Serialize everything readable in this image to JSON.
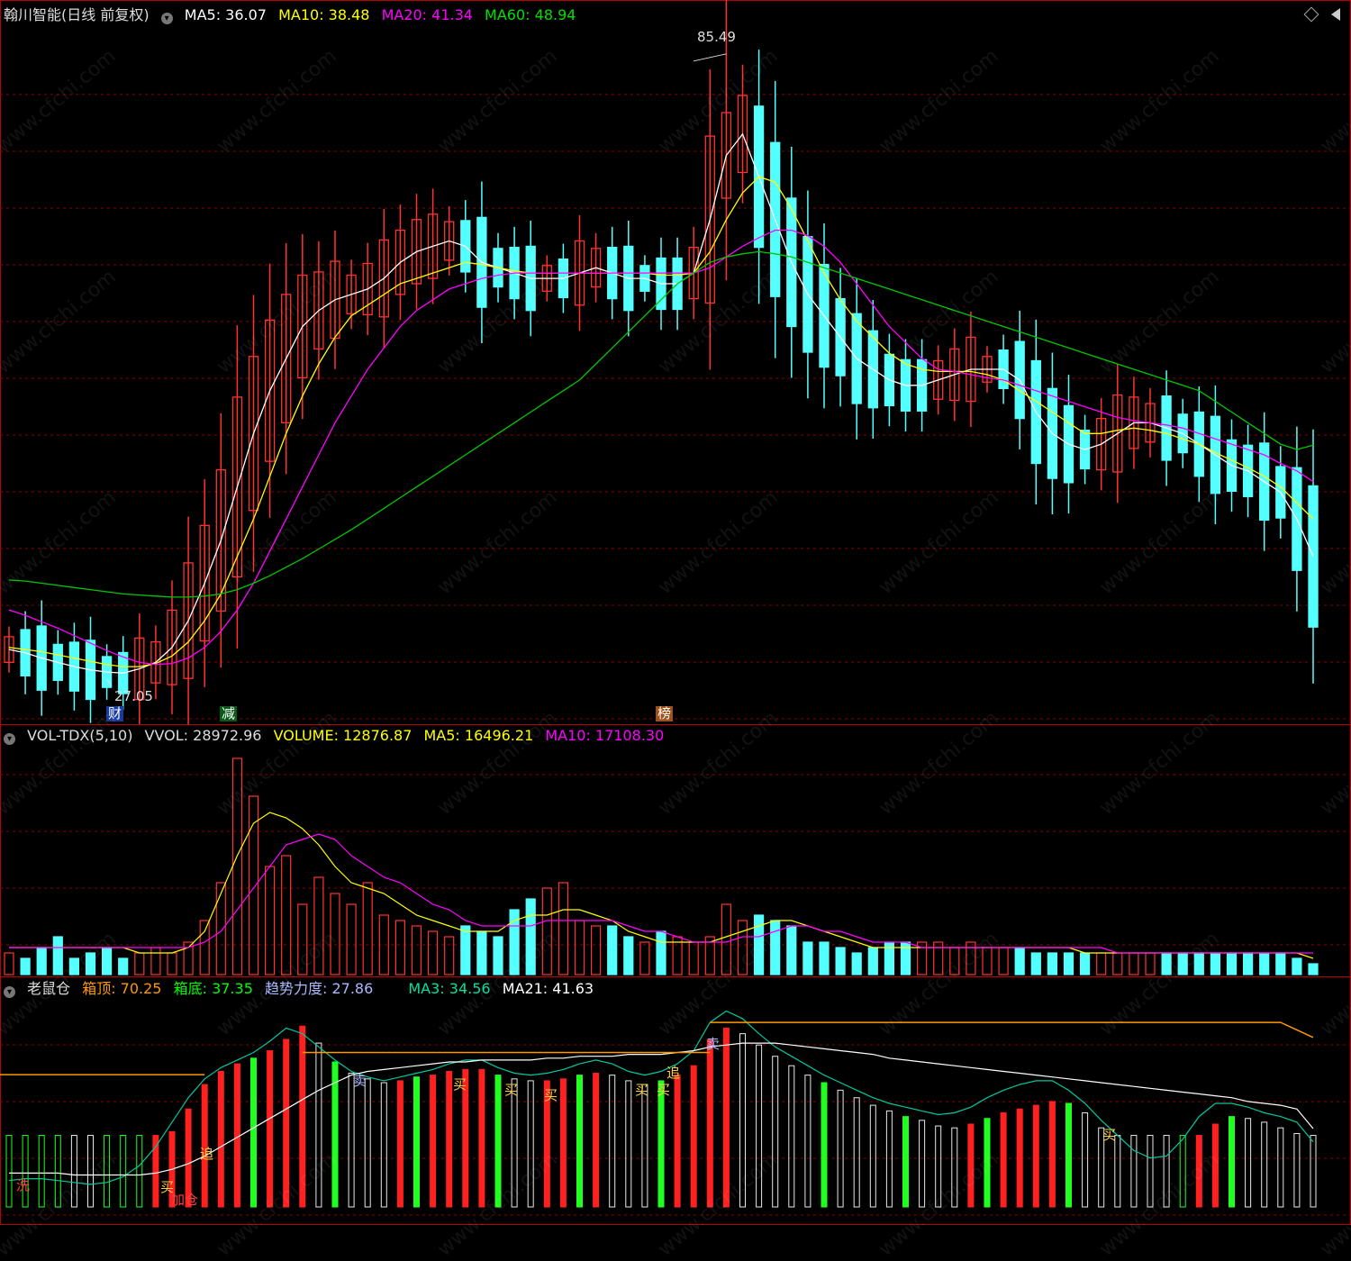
{
  "header": {
    "title": "翰川智能(日线 前复权)",
    "ma5": "MA5: 36.07",
    "ma10": "MA10: 38.48",
    "ma20": "MA20: 41.34",
    "ma60": "MA60: 48.94"
  },
  "price_marks": {
    "high": "85.49",
    "low": "27.05"
  },
  "event_tags": {
    "cai": "财",
    "jian": "减",
    "bang": "榜"
  },
  "volume_header": {
    "name": "VOL-TDX(5,10)",
    "vvol": "VVOL: 28972.96",
    "volume": "VOLUME: 12876.87",
    "ma5": "MA5: 16496.21",
    "ma10": "MA10: 17108.30"
  },
  "indicator_header": {
    "name": "老鼠仓",
    "top": "箱顶: 70.25",
    "bottom": "箱底: 37.35",
    "force": "趋势力度: 27.86",
    "ma3": "MA3: 34.56",
    "ma21": "MA21: 41.63"
  },
  "signals": {
    "buy": "买",
    "sell": "卖",
    "chase": "追",
    "wash": "洗",
    "add": "加仓"
  },
  "watermark": "www.cfchi.com",
  "colors": {
    "up": "#ff3232",
    "down": "#54ffff",
    "ma5": "#ffffff",
    "ma10": "#ffff00",
    "ma20": "#ff00ff",
    "ma60": "#00c800",
    "grid": "#8b0000",
    "box": "#ff9900"
  },
  "chart_data": [
    {
      "type": "candlestick",
      "ylim": [
        24,
        88
      ],
      "series": [
        {
          "name": "MA5",
          "values": [
            29.8,
            29.5,
            29,
            28.6,
            28.2,
            27.9,
            27.7,
            27.6,
            28,
            28.6,
            30,
            32.5,
            36,
            40,
            45,
            50,
            54,
            57,
            60,
            61.5,
            62.5,
            63,
            63.5,
            64.5,
            66,
            67,
            67.5,
            68,
            67.5,
            66,
            65.5,
            65,
            64.5,
            64.5,
            64.5,
            65,
            65.5,
            65,
            64.5,
            64.5,
            64,
            64,
            65,
            70,
            76,
            78,
            74,
            70,
            66,
            63,
            61,
            59,
            57,
            56,
            55,
            54.5,
            54.5,
            55,
            55.5,
            56,
            56,
            56,
            55,
            52,
            50,
            49,
            48.5,
            49,
            50,
            51,
            51,
            50.5,
            50,
            49,
            48,
            47,
            46.5,
            45.5,
            44.5,
            42,
            38.5
          ]
        },
        {
          "name": "MA10",
          "values": [
            30,
            29.8,
            29.6,
            29.3,
            29,
            28.7,
            28.4,
            28.2,
            28.2,
            28.5,
            29.2,
            30.5,
            32.5,
            35,
            38.5,
            42,
            46,
            50,
            53.5,
            56.5,
            59,
            61,
            62,
            63,
            64,
            64.5,
            65,
            65.5,
            66,
            65.8,
            65.5,
            65.2,
            65,
            65,
            65,
            65,
            65,
            65,
            65,
            65,
            64.8,
            64.8,
            65,
            67,
            70,
            72.5,
            74,
            73.5,
            71,
            68,
            65,
            62.5,
            60.5,
            59,
            57.5,
            56.5,
            56,
            55.8,
            55.8,
            55.8,
            55.5,
            55,
            54,
            53,
            52,
            51,
            50,
            50,
            50.3,
            50.5,
            50.3,
            50,
            49.5,
            49,
            48.2,
            47.5,
            46.8,
            46,
            45,
            43.5,
            42
          ]
        },
        {
          "name": "MA20",
          "values": [
            33.5,
            33,
            32.4,
            31.8,
            31.1,
            30.4,
            29.7,
            29.1,
            28.6,
            28.4,
            28.5,
            29,
            30,
            31.5,
            33.5,
            36,
            39,
            42,
            45,
            48,
            51,
            53.5,
            56,
            58,
            60,
            61.5,
            62.5,
            63.5,
            64,
            64.5,
            64.8,
            65,
            65,
            65,
            65,
            65,
            65,
            65,
            65,
            65,
            65,
            65,
            65,
            65.5,
            66.5,
            67.5,
            68.3,
            69,
            69,
            68.5,
            67.5,
            66,
            64,
            62,
            60,
            58.5,
            57,
            56,
            55.8,
            55.5,
            55.2,
            55,
            54.5,
            54,
            53.5,
            53,
            52.5,
            52,
            51.5,
            51.2,
            51,
            50.8,
            50.5,
            50,
            49.5,
            49,
            48.5,
            48,
            47.2,
            46.5,
            45.5
          ]
        },
        {
          "name": "MA60",
          "values": [
            36.3,
            36.2,
            36,
            35.8,
            35.6,
            35.4,
            35.2,
            35,
            34.9,
            34.8,
            34.7,
            34.7,
            34.8,
            35,
            35.4,
            36,
            36.7,
            37.5,
            38.3,
            39.2,
            40.1,
            41,
            42,
            43,
            44,
            45,
            46,
            47,
            48,
            49,
            50,
            51,
            52,
            53,
            54,
            55,
            56.5,
            58,
            59.5,
            61,
            62.5,
            64,
            65,
            66,
            66.5,
            66.8,
            67,
            66.8,
            66.5,
            66,
            65.5,
            65,
            64.5,
            64,
            63.5,
            63,
            62.5,
            62,
            61.5,
            61,
            60.5,
            60,
            59.5,
            59,
            58.5,
            58,
            57.5,
            57,
            56.5,
            56,
            55.5,
            55,
            54.5,
            54,
            53,
            52,
            51,
            50,
            49,
            48.5,
            48.9
          ]
        }
      ],
      "high": 85.49,
      "low": 27.05
    },
    {
      "type": "bar",
      "series": [
        {
          "name": "VOLUME",
          "values": [
            4,
            3,
            5,
            7,
            3,
            4,
            5,
            3,
            4,
            5,
            4,
            6,
            10,
            17,
            40,
            33,
            20,
            22,
            13,
            18,
            15,
            13,
            17,
            11,
            10,
            9,
            8,
            7,
            9,
            8,
            7,
            12,
            14,
            16,
            17,
            10,
            9,
            9,
            7,
            6,
            8,
            7,
            6,
            7,
            13,
            10,
            11,
            10,
            9,
            6,
            6,
            5,
            4,
            5,
            6,
            6,
            6,
            6,
            5,
            6,
            5,
            5,
            5,
            4,
            4,
            4,
            4,
            4,
            4,
            4,
            4,
            4,
            4,
            4,
            4,
            4,
            4,
            4,
            4,
            3,
            2
          ]
        },
        {
          "name": "MA5",
          "values": [
            5,
            5,
            5,
            5,
            5,
            5,
            5,
            5,
            4,
            4,
            4,
            5,
            8,
            15,
            22,
            28,
            30,
            29,
            27,
            24,
            20,
            17,
            16,
            15,
            13,
            11,
            10,
            9,
            8,
            8,
            8,
            10,
            11,
            11,
            12,
            12,
            11,
            10,
            8,
            7,
            6,
            6,
            6,
            6,
            7,
            8,
            9,
            10,
            10,
            9,
            8,
            7,
            6,
            5,
            5,
            5,
            5,
            5,
            5,
            5,
            5,
            5,
            5,
            5,
            5,
            5,
            4,
            4,
            4,
            4,
            4,
            4,
            4,
            4,
            4,
            4,
            4,
            4,
            4,
            4,
            3
          ]
        },
        {
          "name": "MA10",
          "values": [
            5,
            5,
            5,
            5,
            5,
            5,
            5,
            5,
            5,
            5,
            5,
            5,
            6,
            8,
            12,
            16,
            20,
            24,
            25,
            26,
            25,
            22,
            20,
            18,
            17,
            15,
            13,
            12,
            10,
            9,
            9,
            9,
            9,
            10,
            10,
            10,
            10,
            10,
            9,
            8,
            8,
            7,
            6,
            6,
            6,
            7,
            7,
            8,
            9,
            9,
            8,
            8,
            7,
            6,
            6,
            6,
            5,
            5,
            5,
            5,
            5,
            5,
            5,
            5,
            5,
            5,
            5,
            5,
            4,
            4,
            4,
            4,
            4,
            4,
            4,
            4,
            4,
            4,
            4,
            4,
            4
          ]
        }
      ]
    },
    {
      "type": "bar",
      "series": [
        {
          "name": "趋势力度",
          "values": [
            12,
            14,
            15,
            15,
            13,
            11,
            12,
            15,
            20,
            30,
            40,
            52,
            65,
            72,
            76,
            79,
            83,
            89,
            96,
            87,
            77,
            71,
            68,
            66,
            67,
            69,
            70,
            72,
            73,
            73,
            70,
            68,
            67,
            67,
            68,
            70,
            71,
            70,
            67,
            65,
            67,
            70,
            75,
            89,
            95,
            92,
            86,
            80,
            75,
            70,
            66,
            62,
            58,
            54,
            51,
            48,
            46,
            43,
            42,
            44,
            47,
            50,
            52,
            54,
            56,
            55,
            50,
            42,
            35,
            26,
            19,
            14,
            22,
            34,
            44,
            48,
            47,
            45,
            42,
            39,
            27.86
          ]
        },
        {
          "name": "MA3",
          "values": [
            14,
            15,
            15,
            14,
            13,
            12,
            13,
            16,
            22,
            32,
            45,
            58,
            68,
            74,
            78,
            82,
            88,
            95,
            92,
            85,
            78,
            72,
            69,
            67,
            69,
            71,
            73,
            76,
            78,
            78,
            74,
            71,
            70,
            71,
            73,
            76,
            78,
            76,
            72,
            70,
            72,
            76,
            83,
            98,
            104,
            100,
            92,
            85,
            80,
            75,
            70,
            66,
            62,
            58,
            55,
            53,
            51,
            49,
            50,
            53,
            58,
            62,
            65,
            67,
            67,
            62,
            55,
            46,
            38,
            30,
            26,
            27,
            36,
            48,
            55,
            55,
            53,
            50,
            48,
            45,
            34.56
          ]
        },
        {
          "name": "MA21",
          "values": [
            18,
            18,
            18,
            18,
            17,
            17,
            17,
            17,
            17,
            18,
            20,
            23,
            27,
            32,
            37,
            42,
            47,
            52,
            57,
            62,
            66,
            70,
            72,
            73,
            74,
            75,
            76,
            77,
            77,
            78,
            78,
            78,
            78,
            79,
            79,
            80,
            80,
            80,
            81,
            81,
            81,
            82,
            83,
            85,
            86,
            87,
            87,
            87,
            86,
            85,
            84,
            83,
            82,
            81,
            79,
            78,
            77,
            76,
            75,
            74,
            73,
            72,
            71,
            70,
            69,
            68,
            67,
            66,
            65,
            64,
            63,
            62,
            61,
            60,
            59,
            58,
            56,
            55,
            54,
            52,
            41.63
          ]
        }
      ],
      "box_top": 70.25,
      "box_bottom": 37.35
    }
  ]
}
